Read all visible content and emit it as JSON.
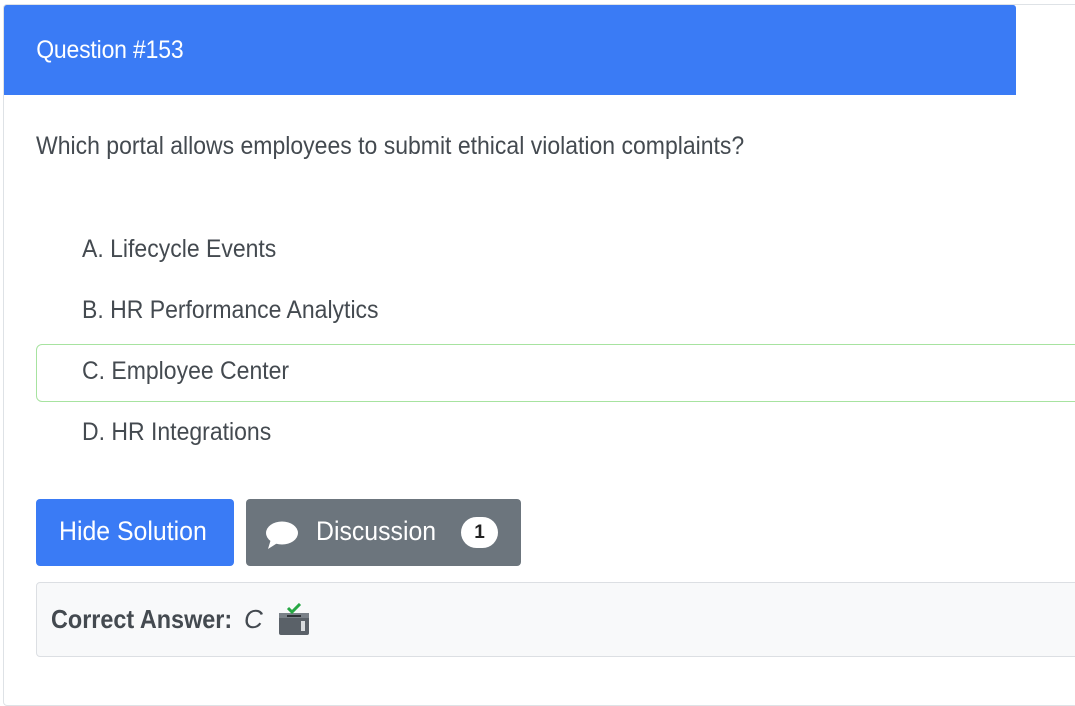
{
  "question": {
    "header": "Question #153",
    "text": "Which portal allows employees to submit ethical violation complaints?"
  },
  "choices": [
    {
      "label": "A. Lifecycle Events",
      "correct": false
    },
    {
      "label": "B. HR Performance Analytics",
      "correct": false
    },
    {
      "label": "C. Employee Center",
      "correct": true
    },
    {
      "label": "D. HR Integrations",
      "correct": false
    }
  ],
  "actions": {
    "hide_solution_label": "Hide Solution",
    "discussion_label": "Discussion",
    "discussion_count": "1"
  },
  "answer": {
    "label": "Correct Answer:",
    "value": "C",
    "icon": "ballot-box-icon"
  },
  "colors": {
    "primary": "#3a7bf5",
    "secondary": "#6c757d",
    "correct_border": "#a7e3a0",
    "text": "#444a50"
  }
}
